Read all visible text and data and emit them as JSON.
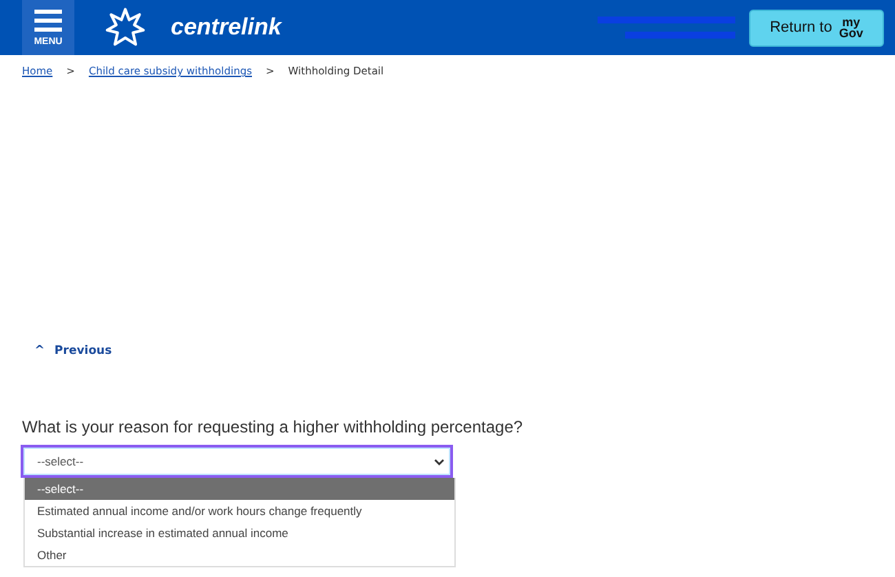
{
  "header": {
    "menu_label": "MENU",
    "brand": "centrelink",
    "return_button": {
      "label": "Return to",
      "logo_top": "my",
      "logo_bottom": "Gov"
    }
  },
  "breadcrumb": [
    {
      "label": "Home",
      "kind": "link"
    },
    {
      "label": ">",
      "kind": "separator"
    },
    {
      "label": "Child care subsidy withholdings",
      "kind": "link"
    },
    {
      "label": ">",
      "kind": "separator"
    },
    {
      "label": "Withholding Detail",
      "kind": "current"
    }
  ],
  "previous_link": {
    "icon": "^",
    "label": "Previous"
  },
  "question": "What is your reason for requesting a higher withholding percentage?",
  "select": {
    "value": "--select--",
    "expanded": true,
    "options": [
      {
        "label": "--select--",
        "selected": true
      },
      {
        "label": "Estimated annual income and/or work hours change frequently",
        "selected": false
      },
      {
        "label": "Substantial increase in estimated annual income",
        "selected": false
      },
      {
        "label": "Other",
        "selected": false
      }
    ]
  }
}
